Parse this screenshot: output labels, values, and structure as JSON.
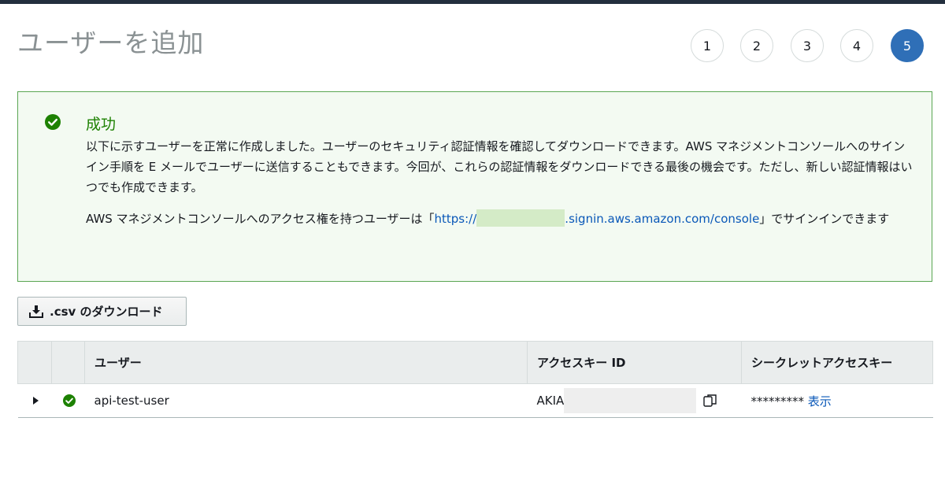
{
  "page": {
    "title": "ユーザーを追加"
  },
  "steps": [
    {
      "label": "1",
      "active": false
    },
    {
      "label": "2",
      "active": false
    },
    {
      "label": "3",
      "active": false
    },
    {
      "label": "4",
      "active": false
    },
    {
      "label": "5",
      "active": true
    }
  ],
  "alert": {
    "title": "成功",
    "body": "以下に示すユーザーを正常に作成しました。ユーザーのセキュリティ認証情報を確認してダウンロードできます。AWS マネジメントコンソールへのサインイン手順を E メールでユーザーに送信することもできます。今回が、これらの認証情報をダウンロードできる最後の機会です。ただし、新しい認証情報はいつでも作成できます。",
    "console_prefix": "AWS マネジメントコンソールへのアクセス権を持つユーザーは「",
    "console_link_start": "https://",
    "console_link_end": ".signin.aws.amazon.com/console",
    "console_suffix": "」でサインインできます"
  },
  "actions": {
    "download_csv": ".csv のダウンロード"
  },
  "table": {
    "headers": {
      "user": "ユーザー",
      "access_key_id": "アクセスキー ID",
      "secret_key": "シークレットアクセスキー"
    },
    "rows": [
      {
        "user": "api-test-user",
        "access_key_prefix": "AKIA",
        "secret_masked": "*********",
        "show_label": "表示"
      }
    ]
  },
  "colors": {
    "accent": "#2f6fb7",
    "success": "#1d8102",
    "link": "#0a58b8",
    "header_bg": "#eaeded"
  }
}
